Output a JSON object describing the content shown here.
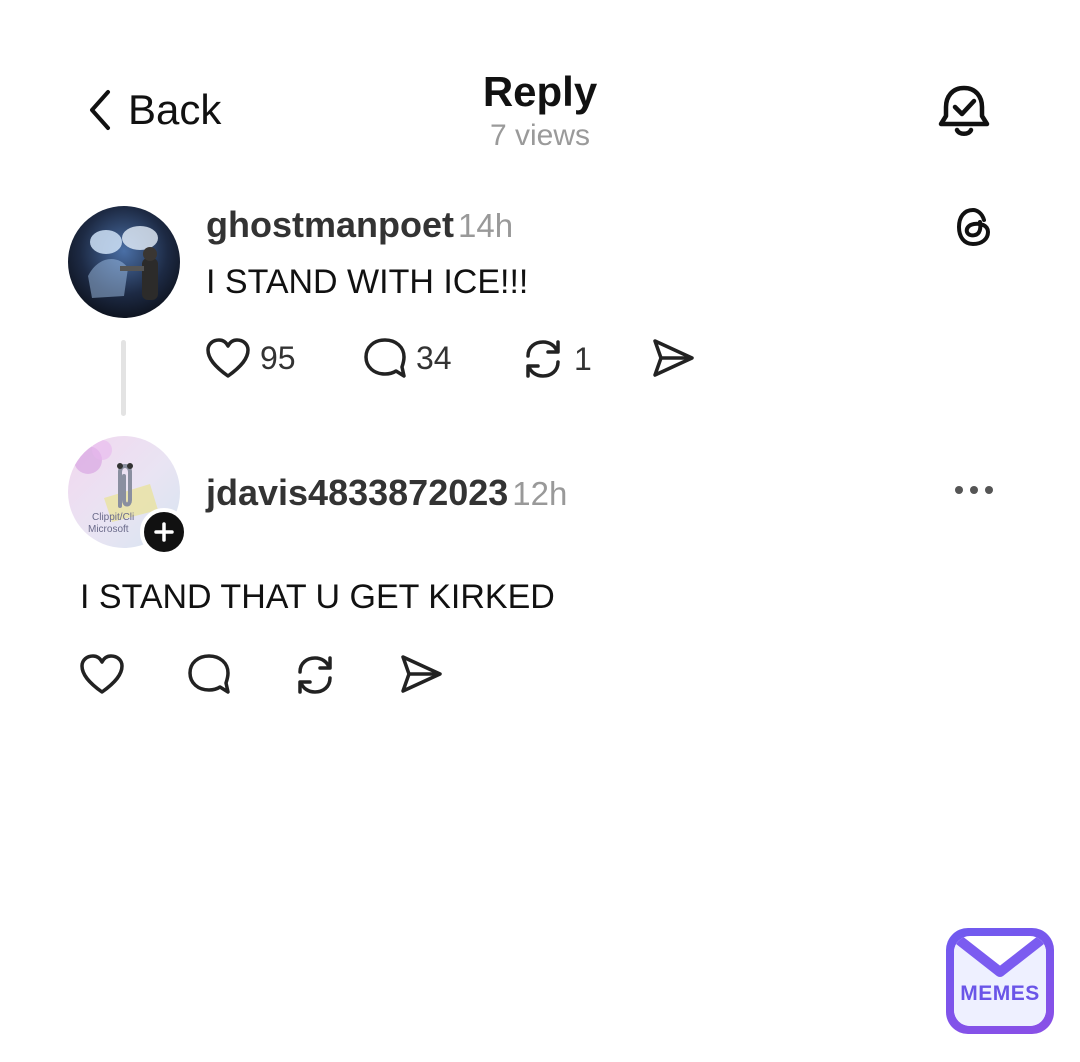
{
  "header": {
    "back_label": "Back",
    "title": "Reply",
    "views": "7 views"
  },
  "posts": [
    {
      "username": "ghostmanpoet",
      "time": "14h",
      "text": "I STAND WITH ICE!!!",
      "likes": "95",
      "replies": "34",
      "reposts": "1"
    },
    {
      "username": "jdavis4833872023",
      "time": "12h",
      "text": "I STAND THAT U GET KIRKED",
      "avatar_text_line1": "Clippit/Cli",
      "avatar_text_line2": "Microsoft"
    }
  ],
  "watermark": {
    "label": "MEMES"
  },
  "colors": {
    "accent": "#7b5cf0",
    "muted": "#999999",
    "text": "#111111"
  }
}
